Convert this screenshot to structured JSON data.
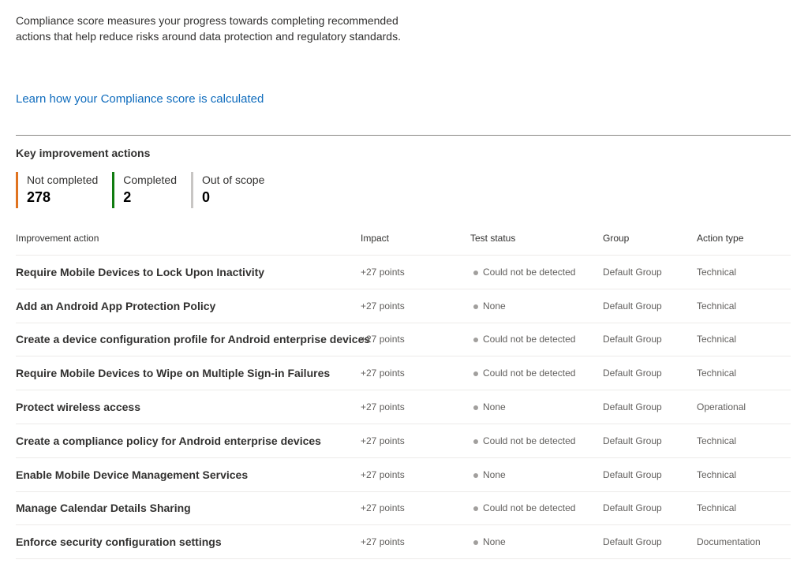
{
  "intro": {
    "text": "Compliance score measures your progress towards completing recommended actions that help reduce risks around data protection and regulatory standards."
  },
  "learn_link": "Learn how your Compliance score is calculated",
  "section_title": "Key improvement actions",
  "stats": [
    {
      "label": "Not completed",
      "value": "278",
      "color": "#e07320"
    },
    {
      "label": "Completed",
      "value": "2",
      "color": "#107c10"
    },
    {
      "label": "Out of scope",
      "value": "0",
      "color": "#c8c6c4"
    }
  ],
  "table": {
    "headers": {
      "action": "Improvement action",
      "impact": "Impact",
      "status": "Test status",
      "group": "Group",
      "type": "Action type"
    },
    "rows": [
      {
        "action": "Require Mobile Devices to Lock Upon Inactivity",
        "impact": "+27 points",
        "status": "Could not be detected",
        "group": "Default Group",
        "type": "Technical"
      },
      {
        "action": "Add an Android App Protection Policy",
        "impact": "+27 points",
        "status": "None",
        "group": "Default Group",
        "type": "Technical"
      },
      {
        "action": "Create a device configuration profile for Android enterprise devices",
        "impact": "+27 points",
        "status": "Could not be detected",
        "group": "Default Group",
        "type": "Technical"
      },
      {
        "action": "Require Mobile Devices to Wipe on Multiple Sign-in Failures",
        "impact": "+27 points",
        "status": "Could not be detected",
        "group": "Default Group",
        "type": "Technical"
      },
      {
        "action": "Protect wireless access",
        "impact": "+27 points",
        "status": "None",
        "group": "Default Group",
        "type": "Operational"
      },
      {
        "action": "Create a compliance policy for Android enterprise devices",
        "impact": "+27 points",
        "status": "Could not be detected",
        "group": "Default Group",
        "type": "Technical"
      },
      {
        "action": "Enable Mobile Device Management Services",
        "impact": "+27 points",
        "status": "None",
        "group": "Default Group",
        "type": "Technical"
      },
      {
        "action": "Manage Calendar Details Sharing",
        "impact": "+27 points",
        "status": "Could not be detected",
        "group": "Default Group",
        "type": "Technical"
      },
      {
        "action": "Enforce security configuration settings",
        "impact": "+27 points",
        "status": "None",
        "group": "Default Group",
        "type": "Documentation"
      }
    ]
  }
}
